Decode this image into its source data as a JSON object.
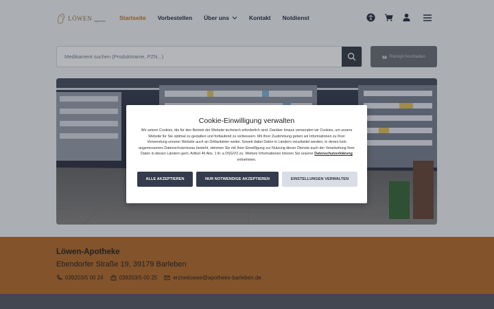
{
  "logo": {
    "brand": "LÖWEN",
    "sub": "Apotheke"
  },
  "nav": {
    "items": [
      "Startseite",
      "Vorbestellen",
      "Über uns",
      "Kontakt",
      "Notdienst"
    ]
  },
  "search": {
    "placeholder": "Medikament suchen (Produktname, PZN...)",
    "rezept_label": "Rezept hochladen"
  },
  "cookie": {
    "title": "Cookie-Einwilligung verwalten",
    "text": "Wir setzen Cookies, die für den Betrieb der Website technisch erforderlich sind. Darüber hinaus verwenden wir Cookies, um unsere Website für Sie optimal zu gestalten und fortlaufend zu verbessern. Mit Ihrer Zustimmung geben wir Informationen zu Ihrer Verwendung unserer Website auch an Drittanbieter weiter. Soweit dabei Daten in Ländern verarbeitet werden, in denen kein angemessenes Datenschutzniveau besteht, stimmen Sie mit Ihrer Einwilligung zur Nutzung dieser Dienste auch der Verarbeitung Ihrer Daten in diesen Ländern gem. Artikel 49 Abs. 1 lit. a DSGVO zu. Weitere Informationen können Sie unserer",
    "link": "Datenschutzerklärung",
    "text_end": "entnehmen.",
    "buttons": [
      "ALLE AKZEPTIEREN",
      "NUR NOTWENDIGE AKZEPTIEREN",
      "EINSTELLUNGEN VERWALTEN"
    ]
  },
  "footer": {
    "name": "Löwen-Apotheke",
    "address": "Ebendorfer Straße 19, 39179 Barleben",
    "phone": "039203/5 00 24",
    "fax": "039203/5 00 25",
    "email": "erzneiloewe@apotheke-barleben.de"
  },
  "colors": {
    "accent": "#c07a2a",
    "footer": "#b96f2f",
    "dark_button": "#343b4c"
  }
}
